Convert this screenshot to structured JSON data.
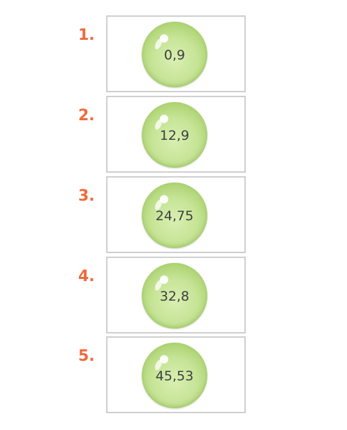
{
  "items": [
    {
      "number": "1.",
      "value": "0,9"
    },
    {
      "number": "2.",
      "value": "12,9"
    },
    {
      "number": "3.",
      "value": "24,75"
    },
    {
      "number": "4.",
      "value": "32,8"
    },
    {
      "number": "5.",
      "value": "45,53"
    }
  ],
  "colors": {
    "number": "#f06a3b",
    "bubble": "#c6e496",
    "border": "#cfcfcf",
    "text": "#3f3f3f"
  }
}
